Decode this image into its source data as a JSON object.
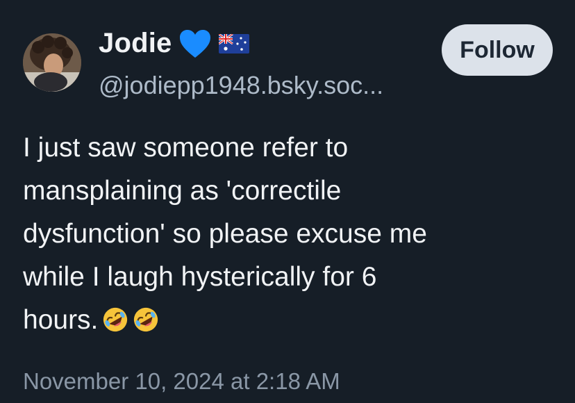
{
  "author": {
    "display_name": "Jodie",
    "badges": [
      "blue-heart-icon",
      "australia-flag-icon"
    ],
    "handle": "@jodiepp1948.bsky.soc..."
  },
  "follow_label": "Follow",
  "post": {
    "lines": [
      "I just saw someone refer to",
      "mansplaining as 'correctile",
      "dysfunction' so please excuse me",
      "while I laugh hysterically for 6",
      "hours."
    ],
    "trailing_emoji": [
      "rolling-on-floor-laughing-emoji",
      "rolling-on-floor-laughing-emoji"
    ]
  },
  "timestamp": "November 10, 2024 at 2:18 AM",
  "colors": {
    "background": "#161e27",
    "text": "#f1f3f5",
    "handle": "#aebbc9",
    "timestamp": "#8a97a6",
    "follow_button": "#dce2ea",
    "heart": "#1a8cff"
  }
}
